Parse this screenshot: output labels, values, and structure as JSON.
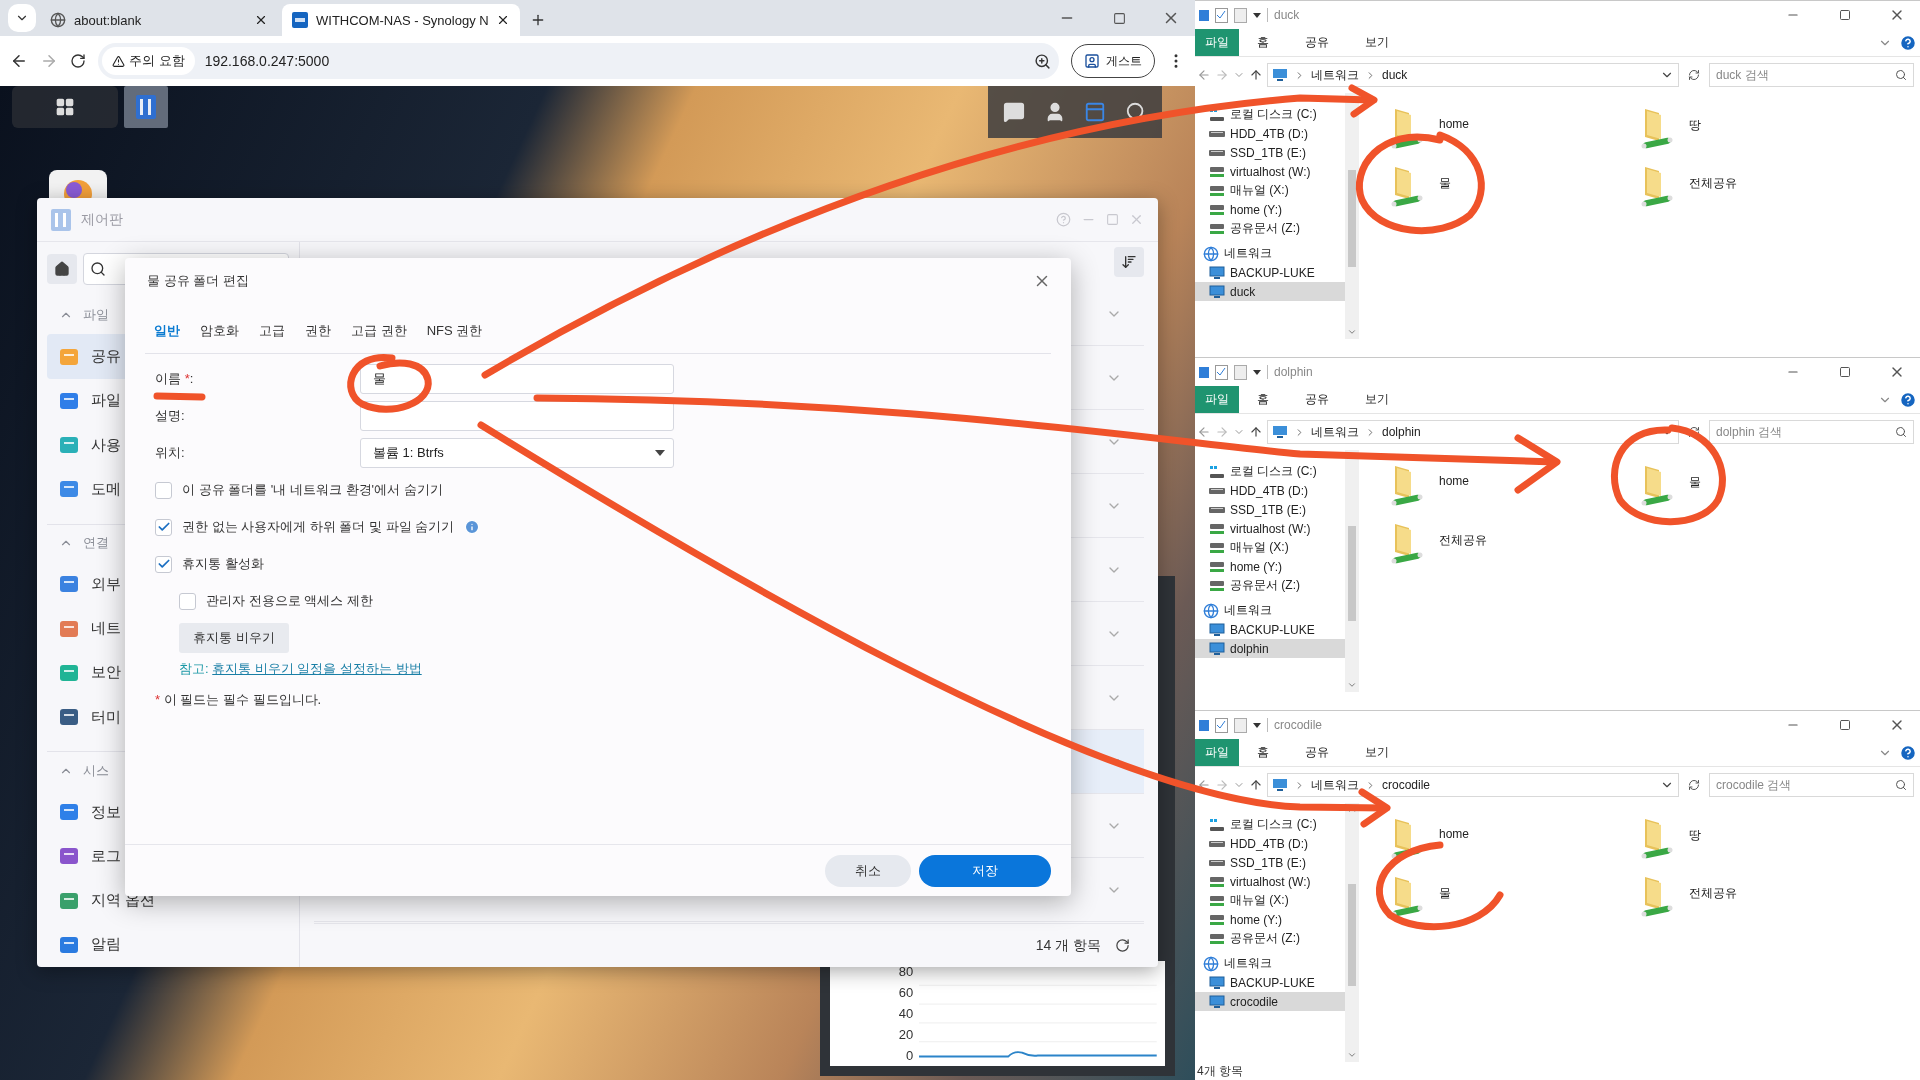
{
  "browser": {
    "tabs": [
      {
        "title": "about:blank",
        "selected": false
      },
      {
        "title": "WITHCOM-NAS - Synology N",
        "selected": true
      }
    ],
    "security_chip": "주의 요함",
    "url": "192.168.0.247:5000",
    "profile": "게스트"
  },
  "control_panel": {
    "title": "제어판",
    "sidebar": [
      {
        "kind": "header",
        "label": "파일",
        "expanded": true
      },
      {
        "kind": "item",
        "label": "공유",
        "selected": true
      },
      {
        "kind": "item",
        "label": "파일",
        "selected": false
      },
      {
        "kind": "item",
        "label": "사용",
        "selected": false
      },
      {
        "kind": "item",
        "label": "도메",
        "selected": false
      },
      {
        "kind": "header",
        "label": "연결",
        "expanded": true
      },
      {
        "kind": "item",
        "label": "외부",
        "selected": false
      },
      {
        "kind": "item",
        "label": "네트",
        "selected": false
      },
      {
        "kind": "item",
        "label": "보안",
        "selected": false
      },
      {
        "kind": "item",
        "label": "터미",
        "selected": false
      },
      {
        "kind": "header",
        "label": "시스",
        "expanded": true
      },
      {
        "kind": "item",
        "label": "정보",
        "selected": false
      },
      {
        "kind": "item",
        "label": "로그",
        "selected": false
      },
      {
        "kind": "item",
        "label": "지역 옵션",
        "selected": false
      },
      {
        "kind": "item",
        "label": "알림",
        "selected": false
      }
    ],
    "rows": [
      {
        "selected": false
      },
      {
        "selected": false
      },
      {
        "selected": false
      },
      {
        "selected": false
      },
      {
        "selected": false
      },
      {
        "selected": false
      },
      {
        "selected": false
      },
      {
        "selected": true
      },
      {
        "selected": false
      },
      {
        "selected": false
      }
    ],
    "footer_count": "14 개 항목"
  },
  "dialog": {
    "title": "물 공유 폴더 편집",
    "tabs": [
      {
        "label": "일반",
        "selected": true
      },
      {
        "label": "암호화",
        "selected": false
      },
      {
        "label": "고급",
        "selected": false
      },
      {
        "label": "권한",
        "selected": false
      },
      {
        "label": "고급 권한",
        "selected": false
      },
      {
        "label": "NFS 권한",
        "selected": false
      }
    ],
    "fields": [
      {
        "kind": "text",
        "label": "이름",
        "required_mark": "*",
        "colon": ":",
        "value": "물"
      },
      {
        "kind": "text",
        "label": "설명:"
      },
      {
        "kind": "select",
        "label": "위치:",
        "value": "볼륨 1:  Btrfs"
      }
    ],
    "options": [
      {
        "label": "이 공유 폴더를 '내 네트워크 환경'에서 숨기기",
        "checked": false
      },
      {
        "label": "권한 없는 사용자에게 하위 폴더 및 파일 숨기기",
        "checked": true,
        "info": true
      },
      {
        "label": "휴지통 활성화",
        "checked": true,
        "children": [
          {
            "label": "관리자 전용으로 액세스 제한",
            "checked": false
          }
        ],
        "button": "휴지통 비우기",
        "note": {
          "prefix": "참고:",
          "link": "휴지통 비우기 일정을 설정하는 방법"
        }
      }
    ],
    "footnote": {
      "mark": "*",
      "text": "이 필드는 필수 필드입니다."
    },
    "buttons": [
      {
        "kind": "secondary",
        "label": "취소"
      },
      {
        "kind": "primary",
        "label": "저장"
      }
    ]
  },
  "widget": {
    "y_axis_labels": [
      "80",
      "60",
      "40",
      "20",
      "0"
    ]
  },
  "explorers": [
    {
      "title": "duck",
      "ribbon_tabs": [
        {
          "label": "파일",
          "selected": true
        },
        {
          "label": "홈",
          "selected": false
        },
        {
          "label": "공유",
          "selected": false
        },
        {
          "label": "보기",
          "selected": false
        }
      ],
      "breadcrumb": [
        "네트워크",
        "duck"
      ],
      "search_placeholder": "duck 검색",
      "nav": [
        {
          "kind": "system-drive",
          "label": "로컬 디스크 (C:)",
          "selected": false
        },
        {
          "kind": "drive",
          "label": "HDD_4TB (D:)",
          "selected": false
        },
        {
          "kind": "drive",
          "label": "SSD_1TB (E:)",
          "selected": false
        },
        {
          "kind": "network-drive",
          "label": "virtualhost (W:)",
          "selected": false
        },
        {
          "kind": "network-drive",
          "label": "매뉴얼 (X:)",
          "selected": false
        },
        {
          "kind": "network-drive",
          "label": "home (Y:)",
          "selected": false
        },
        {
          "kind": "network-drive",
          "label": "공유문서 (Z:)",
          "selected": false
        },
        {
          "kind": "network",
          "label": "네트워크",
          "selected": false
        },
        {
          "kind": "computer",
          "label": "BACKUP-LUKE",
          "selected": false
        },
        {
          "kind": "computer",
          "label": "duck",
          "selected": true
        }
      ],
      "folders": [
        "home",
        "땅",
        "물",
        "전체공유"
      ]
    },
    {
      "title": "dolphin",
      "ribbon_tabs": [
        {
          "label": "파일",
          "selected": true
        },
        {
          "label": "홈",
          "selected": false
        },
        {
          "label": "공유",
          "selected": false
        },
        {
          "label": "보기",
          "selected": false
        }
      ],
      "breadcrumb": [
        "네트워크",
        "dolphin"
      ],
      "search_placeholder": "dolphin 검색",
      "nav": [
        {
          "kind": "system-drive",
          "label": "로컬 디스크 (C:)",
          "selected": false
        },
        {
          "kind": "drive",
          "label": "HDD_4TB (D:)",
          "selected": false
        },
        {
          "kind": "drive",
          "label": "SSD_1TB (E:)",
          "selected": false
        },
        {
          "kind": "network-drive",
          "label": "virtualhost (W:)",
          "selected": false
        },
        {
          "kind": "network-drive",
          "label": "매뉴얼 (X:)",
          "selected": false
        },
        {
          "kind": "network-drive",
          "label": "home (Y:)",
          "selected": false
        },
        {
          "kind": "network-drive",
          "label": "공유문서 (Z:)",
          "selected": false
        },
        {
          "kind": "network",
          "label": "네트워크",
          "selected": false
        },
        {
          "kind": "computer",
          "label": "BACKUP-LUKE",
          "selected": false
        },
        {
          "kind": "computer",
          "label": "dolphin",
          "selected": true
        }
      ],
      "folders": [
        "home",
        "물",
        "전체공유"
      ]
    },
    {
      "title": "crocodile",
      "ribbon_tabs": [
        {
          "label": "파일",
          "selected": true
        },
        {
          "label": "홈",
          "selected": false
        },
        {
          "label": "공유",
          "selected": false
        },
        {
          "label": "보기",
          "selected": false
        }
      ],
      "breadcrumb": [
        "네트워크",
        "crocodile"
      ],
      "search_placeholder": "crocodile 검색",
      "nav": [
        {
          "kind": "system-drive",
          "label": "로컬 디스크 (C:)",
          "selected": false
        },
        {
          "kind": "drive",
          "label": "HDD_4TB (D:)",
          "selected": false
        },
        {
          "kind": "drive",
          "label": "SSD_1TB (E:)",
          "selected": false
        },
        {
          "kind": "network-drive",
          "label": "virtualhost (W:)",
          "selected": false
        },
        {
          "kind": "network-drive",
          "label": "매뉴얼 (X:)",
          "selected": false
        },
        {
          "kind": "network-drive",
          "label": "home (Y:)",
          "selected": false
        },
        {
          "kind": "network-drive",
          "label": "공유문서 (Z:)",
          "selected": false
        },
        {
          "kind": "network",
          "label": "네트워크",
          "selected": false
        },
        {
          "kind": "computer",
          "label": "BACKUP-LUKE",
          "selected": false
        },
        {
          "kind": "computer",
          "label": "crocodile",
          "selected": true
        }
      ],
      "folders": [
        "home",
        "땅",
        "물",
        "전체공유"
      ],
      "status": "4개 항목"
    }
  ]
}
